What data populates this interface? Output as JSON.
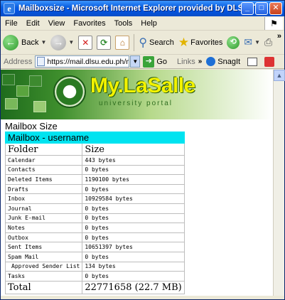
{
  "window": {
    "title": "Mailboxsize - Microsoft Internet Explorer provided by DLSU IT Center",
    "controls": [
      "minimize",
      "maximize",
      "close"
    ]
  },
  "menubar": {
    "items": [
      "File",
      "Edit",
      "View",
      "Favorites",
      "Tools",
      "Help"
    ]
  },
  "toolbar": {
    "back_label": "Back",
    "search_label": "Search",
    "favorites_label": "Favorites"
  },
  "addressbar": {
    "label": "Address",
    "url": "https://mail.dlsu.edu.ph/mailboxsiz",
    "go_label": "Go",
    "links_label": "Links",
    "snagit_label": "SnagIt"
  },
  "banner": {
    "brand": "My.LaSalle",
    "tagline": "university portal"
  },
  "page": {
    "section_title": "Mailbox Size",
    "mailbox_header": "Mailbox - username",
    "columns": [
      "Folder",
      "Size"
    ],
    "rows": [
      {
        "folder": "Calendar",
        "size": "443 bytes",
        "indent": false
      },
      {
        "folder": "Contacts",
        "size": "0 bytes",
        "indent": false
      },
      {
        "folder": "Deleted Items",
        "size": "1190100 bytes",
        "indent": false
      },
      {
        "folder": "Drafts",
        "size": "0 bytes",
        "indent": false
      },
      {
        "folder": "Inbox",
        "size": "10929584 bytes",
        "indent": false
      },
      {
        "folder": "Journal",
        "size": "0 bytes",
        "indent": false
      },
      {
        "folder": "Junk E-mail",
        "size": "0 bytes",
        "indent": false
      },
      {
        "folder": "Notes",
        "size": "0 bytes",
        "indent": false
      },
      {
        "folder": "Outbox",
        "size": "0 bytes",
        "indent": false
      },
      {
        "folder": "Sent Items",
        "size": "10651397 bytes",
        "indent": false
      },
      {
        "folder": "Spam Mail",
        "size": "0 bytes",
        "indent": false
      },
      {
        "folder": "Approved Sender List",
        "size": "134 bytes",
        "indent": true
      },
      {
        "folder": "Tasks",
        "size": "0 bytes",
        "indent": false
      }
    ],
    "total_label": "Total",
    "total_value": "22771658 (22.7 MB)"
  },
  "colors": {
    "titlebar": "#0054e3",
    "header_highlight": "#00e3f0",
    "brand_yellow": "#f2f200",
    "banner_green": "#3f8f2d"
  }
}
